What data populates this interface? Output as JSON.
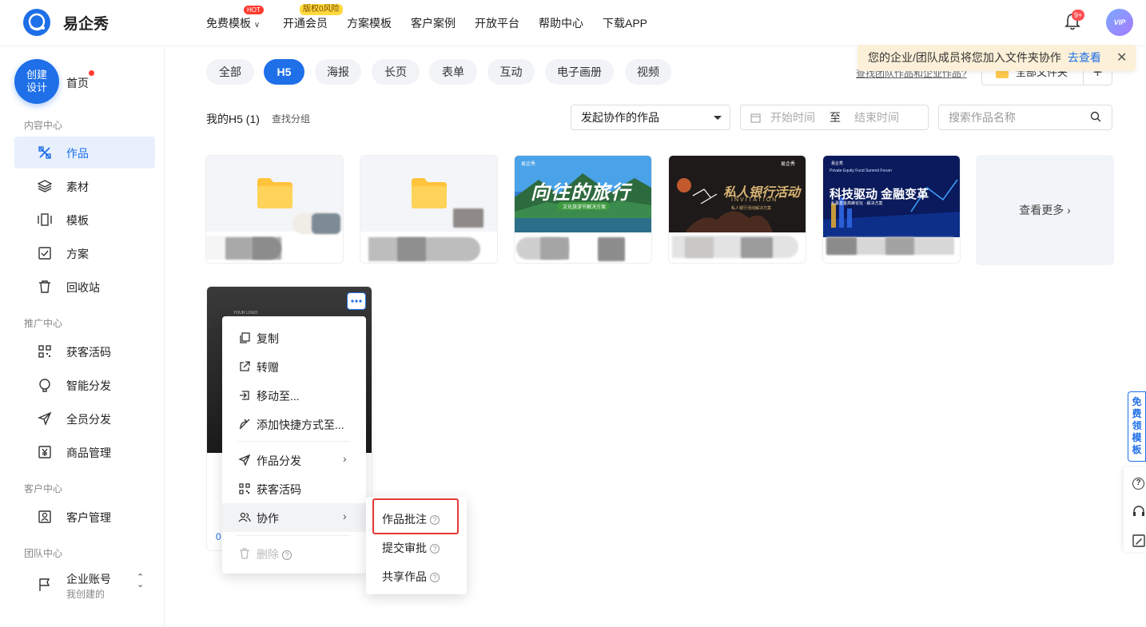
{
  "header": {
    "logo_text": "易企秀",
    "nav": [
      "免费模板",
      "开通会员",
      "方案模板",
      "客户案例",
      "开放平台",
      "帮助中心",
      "下载APP"
    ],
    "hot_badge": "HOT",
    "vip_badge": "版权0风险",
    "notification_count": "9+",
    "avatar_text": "VIP"
  },
  "sidebar": {
    "create_button": "创建设计",
    "home": "首页",
    "sections": {
      "content": "内容中心",
      "promo": "推广中心",
      "customer": "客户中心",
      "team": "团队中心"
    },
    "content_items": [
      "作品",
      "素材",
      "模板",
      "方案",
      "回收站"
    ],
    "promo_items": [
      "获客活码",
      "智能分发",
      "全员分发",
      "商品管理"
    ],
    "customer_items": [
      "客户管理"
    ],
    "account": {
      "label": "企业账号",
      "sub": "我创建的"
    }
  },
  "main": {
    "tabs": [
      "全部",
      "H5",
      "海报",
      "长页",
      "表单",
      "互动",
      "电子画册",
      "视频"
    ],
    "active_tab": "H5",
    "team_link": "查找团队作品和企业作品?",
    "all_folders": "全部文件夹",
    "add_folder": "+",
    "toast": {
      "text": "您的企业/团队成员将您加入文件夹协作",
      "link": "去查看",
      "close": "✕"
    },
    "list_title": "我的H5 (1)",
    "find_group": "查找分组",
    "filter_select": "发起协作的作品",
    "date_start": "开始时间",
    "date_sep": "至",
    "date_end": "结束时间",
    "search_placeholder": "搜索作品名称",
    "view_more": "查看更多 ›",
    "card_texts": {
      "travel_title": "向往的旅行",
      "travel_sub": "文化旅游节解决方案",
      "bank_title": "私人银行活动",
      "bank_en": "INVITATION",
      "bank_sub": "私人银行活动解决方案",
      "tech_title": "科技驱动 金融变革",
      "tech_en": "Private Equity Fund Summit Forum",
      "tech_sub": "私募基金高峰论坛 · 解决方案",
      "brand": "易企秀"
    },
    "dark_card": {
      "label": "YOUR LOGO",
      "initial": "0"
    }
  },
  "context_menu": {
    "items": [
      "复制",
      "转赠",
      "移动至...",
      "添加快捷方式至...",
      "作品分发",
      "获客活码",
      "协作",
      "删除"
    ],
    "question_mark": "?"
  },
  "submenu": {
    "items": [
      "作品批注",
      "提交审批",
      "共享作品"
    ]
  },
  "right_float": {
    "free_template": "免费领模板",
    "help": "?"
  }
}
